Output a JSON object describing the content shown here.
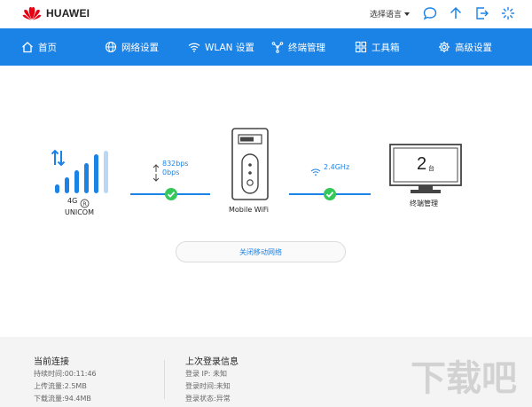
{
  "header": {
    "brand": "HUAWEI",
    "language_label": "选择语言",
    "icons": [
      "message-icon",
      "update-icon",
      "logout-icon",
      "loading-icon"
    ]
  },
  "nav": {
    "items": [
      {
        "label": "首页",
        "icon": "home-icon"
      },
      {
        "label": "网络设置",
        "icon": "globe-icon"
      },
      {
        "label": "WLAN 设置",
        "icon": "wifi-icon"
      },
      {
        "label": "终端管理",
        "icon": "devices-icon"
      },
      {
        "label": "工具箱",
        "icon": "toolbox-icon"
      },
      {
        "label": "高级设置",
        "icon": "gear-icon"
      }
    ]
  },
  "status": {
    "network_type": "4G",
    "carrier": "UNICOM",
    "upload_speed": "832bps",
    "download_speed": "0bps",
    "device_name": "Mobile WiFi",
    "wifi_band": "2.4GHz",
    "connected_devices": "2",
    "devices_unit": "台",
    "terminal_label": "终端管理",
    "close_network_button": "关闭移动网络"
  },
  "footer": {
    "current": {
      "title": "当前连接",
      "duration": "持续时间:00:11:46",
      "upload": "上传流量:2.5MB",
      "download": "下载流量:94.4MB"
    },
    "last_login": {
      "title": "上次登录信息",
      "ip": "登录 IP:  未知",
      "time": "登录时间:未知",
      "state": "登录状态:异常"
    },
    "watermark": "下载吧"
  },
  "colors": {
    "primary": "#1c83e6",
    "success": "#34c759",
    "brand_red": "#e60012"
  }
}
